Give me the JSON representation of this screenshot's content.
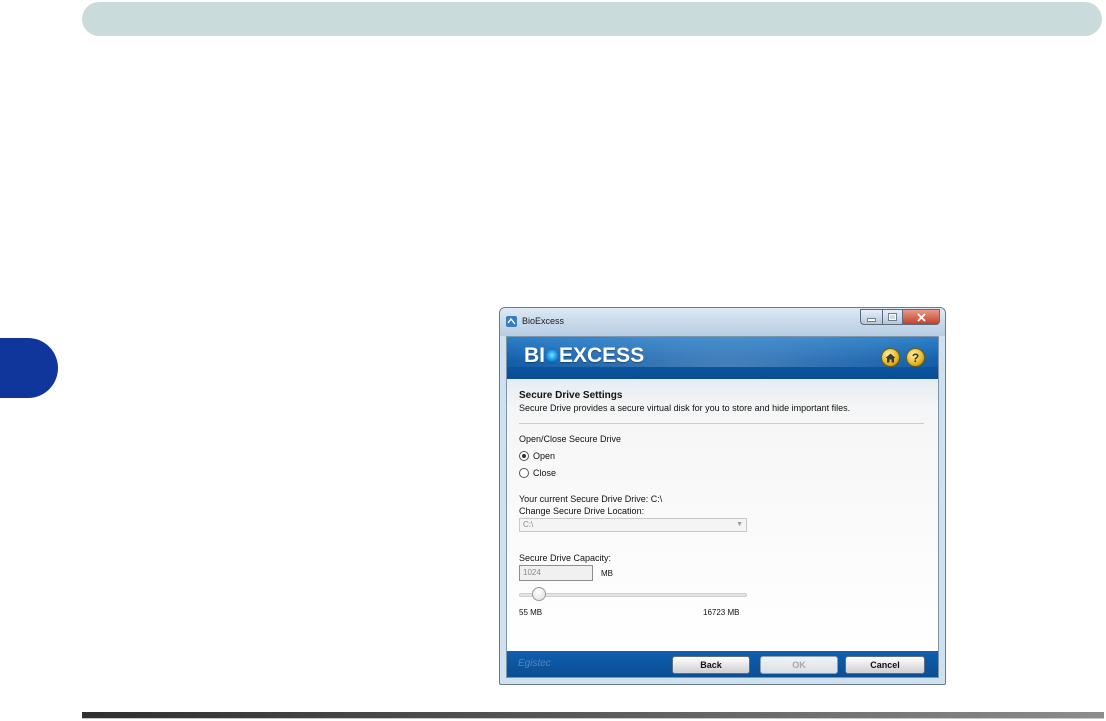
{
  "window": {
    "title": "BioExcess"
  },
  "banner": {
    "logo_prefix": "BI",
    "logo_suffix": "EXCESS"
  },
  "settings": {
    "section_title": "Secure Drive Settings",
    "section_desc": "Secure Drive provides a secure virtual disk for you to store and hide important files.",
    "open_close_label": "Open/Close Secure Drive",
    "radio_open": "Open",
    "radio_close": "Close",
    "selected": "Open",
    "current_drive": "Your current Secure Drive Drive: C:\\",
    "change_location_label": "Change Secure Drive Location:",
    "location_value": "C:\\",
    "capacity_label": "Secure Drive Capacity:",
    "capacity_value": "1024",
    "capacity_unit": "MB",
    "slider_min": "55 MB",
    "slider_max": "16723 MB",
    "slider_level": 0.06
  },
  "footer": {
    "brand": "Egistec",
    "back": "Back",
    "ok": "OK",
    "cancel": "Cancel"
  },
  "colors": {
    "banner": "#0c5aa8",
    "side_tab": "#11369b",
    "top_bar": "#c9dcdb"
  }
}
